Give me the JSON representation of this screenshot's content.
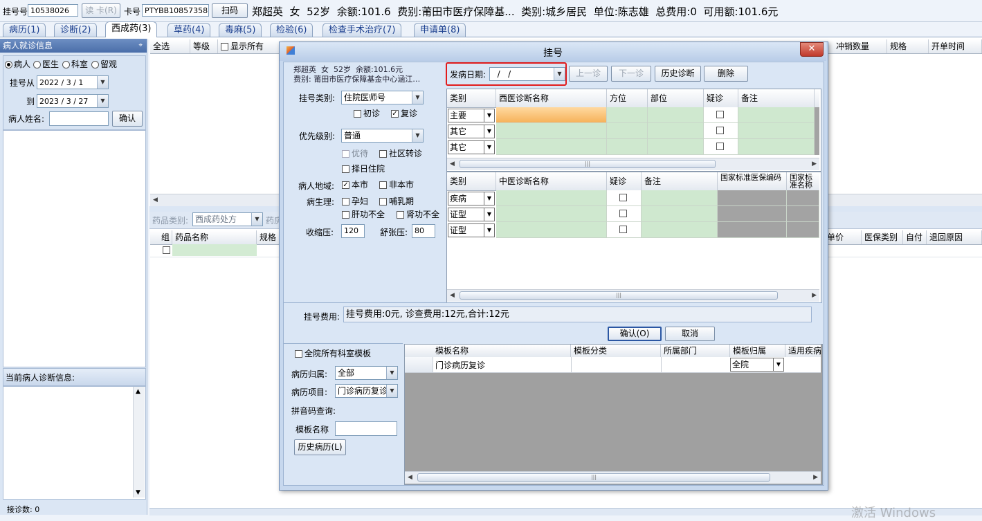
{
  "topbar": {
    "reg_no_label": "挂号号",
    "reg_no_value": "10538026",
    "read_card_button": "读 卡(R)",
    "card_no_label": "卡号",
    "card_no_value": "PTYBB10857358",
    "scan_button": "扫码",
    "patient_info": "郑超英  女  52岁  余额:101.6  费别:莆田市医疗保障基...  类别:城乡居民  单位:陈志雄  总费用:0  可用额:101.6元"
  },
  "tabs": [
    "病历(1)",
    "诊断(2)",
    "西成药(3)",
    "草药(4)",
    "毒麻(5)",
    "检验(6)",
    "检查手术治疗(7)",
    "申请单(8)"
  ],
  "left_panel": {
    "header": "病人就诊信息",
    "pin_icon": "pin-icon",
    "radios": [
      "病人",
      "医生",
      "科室",
      "留观"
    ],
    "reg_from_label": "挂号从",
    "reg_from_value": "2022 / 3 / 1",
    "to_label": "到",
    "to_value": "2023 / 3 / 27",
    "name_label": "病人姓名:",
    "confirm_button": "确认",
    "diag_header": "当前病人诊断信息:",
    "visit_count": "接诊数: 0"
  },
  "bg_grid": {
    "columns": [
      "全选",
      "等级",
      "显示所有"
    ],
    "right_columns": [
      "冲销数量",
      "规格",
      "开单时间"
    ],
    "drug_type_label": "药品类别:",
    "drug_type_value": "西成药处方",
    "drug_room_label": "药房",
    "drug_columns": [
      "组",
      "药品名称",
      "规格"
    ],
    "drug_right_columns": [
      "单价",
      "医保类别",
      "自付",
      "退回原因"
    ]
  },
  "dialog": {
    "title": "挂号",
    "close_icon": "close-icon",
    "patient_line1": "郑超英  女  52岁  余额:101.6元",
    "patient_line2": "费别: 莆田市医疗保障基金中心涵江…",
    "onset_label": "发病日期:",
    "onset_value": "  /   /",
    "prev_button": "上一诊",
    "next_button": "下一诊",
    "history_diag_button": "历史诊断",
    "delete_button": "删除",
    "reg_type_label": "挂号类别:",
    "reg_type_value": "住院医师号",
    "first_visit": "初诊",
    "return_visit": "复诊",
    "priority_label": "优先级别:",
    "priority_value": "普通",
    "preferential": "优待",
    "community_transfer": "社区转诊",
    "scheduled_admission": "择日住院",
    "region_label": "病人地域:",
    "local": "本市",
    "non_local": "非本市",
    "physio_label": "病生理:",
    "pregnant": "孕妇",
    "lactation": "哺乳期",
    "liver": "肝功不全",
    "kidney": "肾功不全",
    "systolic_label": "收缩压:",
    "systolic_value": "120",
    "diastolic_label": "舒张压:",
    "diastolic_value": "80",
    "west_columns": [
      "类别",
      "西医诊断名称",
      "方位",
      "部位",
      "疑诊",
      "备注"
    ],
    "west_rows": [
      "主要",
      "其它",
      "其它"
    ],
    "tcm_columns": [
      "类别",
      "中医诊断名称",
      "疑诊",
      "备注",
      "国家标准医保编码",
      "国家标准名称"
    ],
    "tcm_rows": [
      "疾病",
      "证型",
      "证型"
    ],
    "fee_label": "挂号费用:",
    "fee_value": "挂号费用:0元, 诊查费用:12元,合计:12元",
    "ok_button": "确认(O)",
    "cancel_button": "取消",
    "all_dept_templates": "全院所有科室模板",
    "record_owner_label": "病历归属:",
    "record_owner_value": "全部",
    "record_item_label": "病历项目:",
    "record_item_value": "门诊病历复诊",
    "pinyin_label": "拼音码查询:",
    "template_name_label": "模板名称",
    "history_record_button": "历史病历(L)",
    "template_columns": [
      "模板名称",
      "模板分类",
      "所属部门",
      "模板归属",
      "适用疾病"
    ],
    "template_row": {
      "name": "门诊病历复诊",
      "owner": "全院"
    }
  },
  "watermark": "激活 Windows"
}
